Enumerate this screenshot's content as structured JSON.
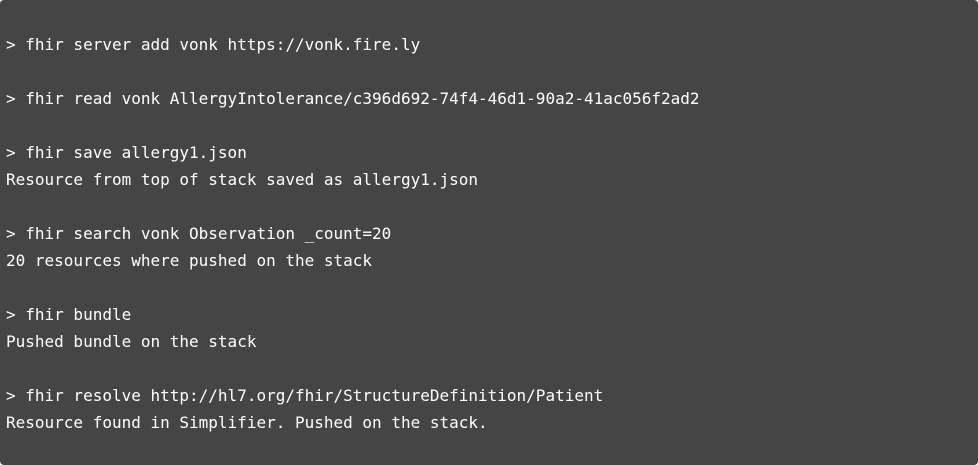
{
  "terminal": {
    "prompt": "> ",
    "entries": [
      {
        "command": "fhir server add vonk https://vonk.fire.ly",
        "output": ""
      },
      {
        "command": "fhir read vonk AllergyIntolerance/c396d692-74f4-46d1-90a2-41ac056f2ad2",
        "output": ""
      },
      {
        "command": "fhir save allergy1.json",
        "output": "Resource from top of stack saved as allergy1.json"
      },
      {
        "command": "fhir search vonk Observation _count=20",
        "output": "20 resources where pushed on the stack"
      },
      {
        "command": "fhir bundle",
        "output": "Pushed bundle on the stack"
      },
      {
        "command": "fhir resolve http://hl7.org/fhir/StructureDefinition/Patient",
        "output": "Resource found in Simplifier. Pushed on the stack."
      }
    ]
  },
  "colors": {
    "background": "#454545",
    "text": "#ffffff"
  }
}
